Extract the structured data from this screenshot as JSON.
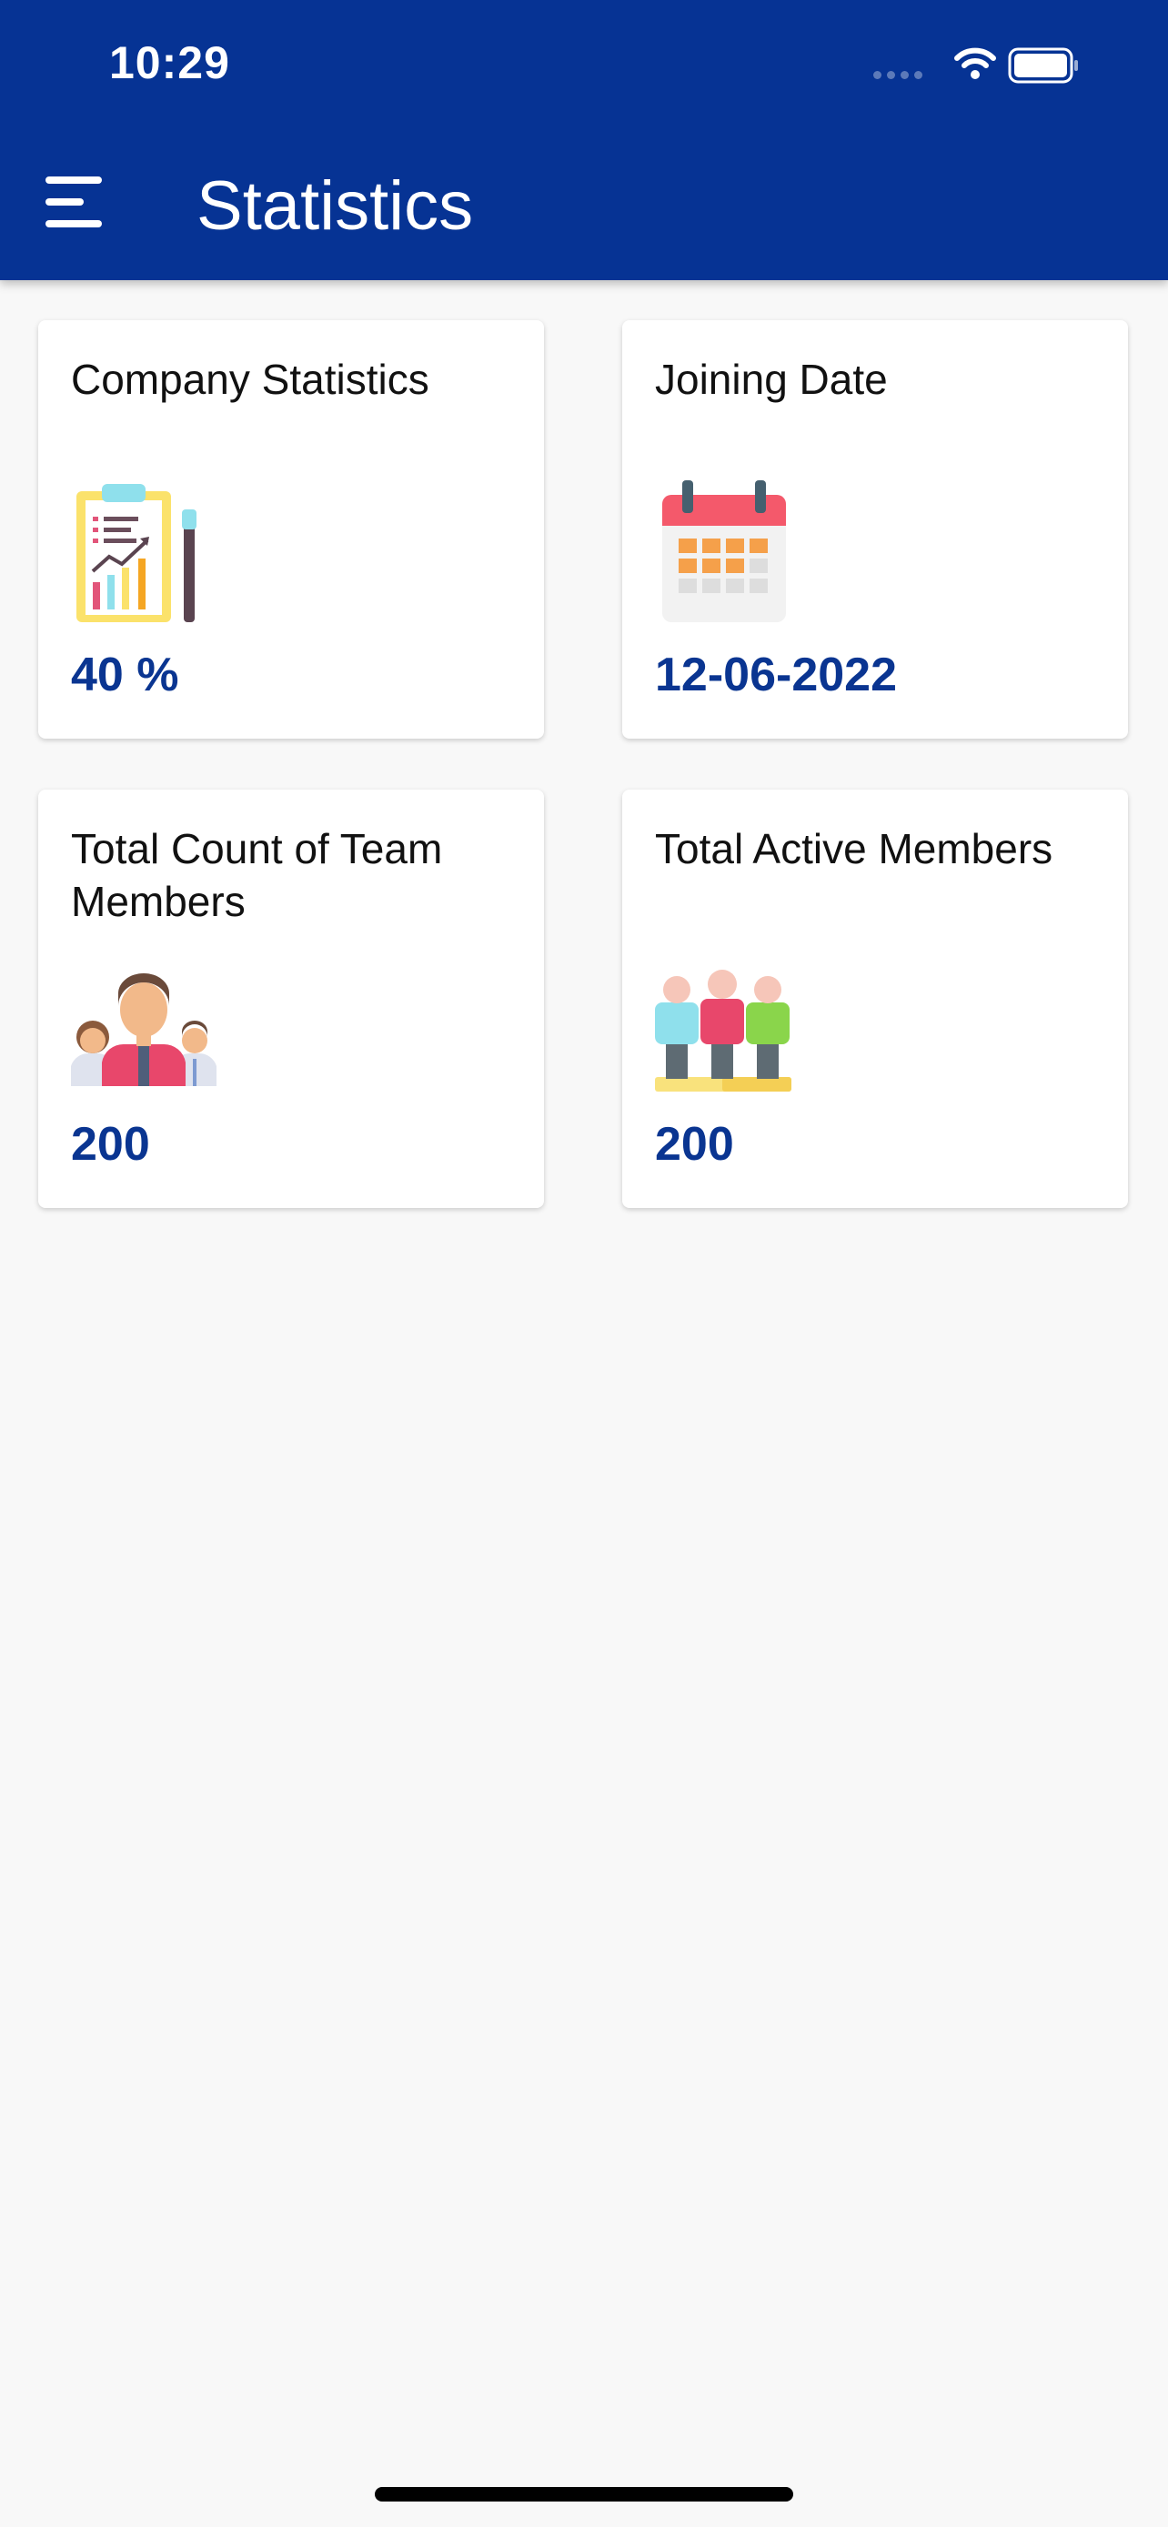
{
  "status_bar": {
    "time": "10:29"
  },
  "header": {
    "title": "Statistics"
  },
  "cards": [
    {
      "title": "Company Statistics",
      "value": "40 %",
      "icon": "report-clipboard-icon"
    },
    {
      "title": "Joining Date",
      "value": "12-06-2022",
      "icon": "calendar-icon"
    },
    {
      "title": "Total Count of Team Members",
      "value": "200",
      "icon": "team-members-icon"
    },
    {
      "title": "Total Active Members",
      "value": "200",
      "icon": "active-members-icon"
    }
  ],
  "colors": {
    "appbar": "#063394",
    "value_text": "#0a3591",
    "background": "#f8f8f8"
  }
}
